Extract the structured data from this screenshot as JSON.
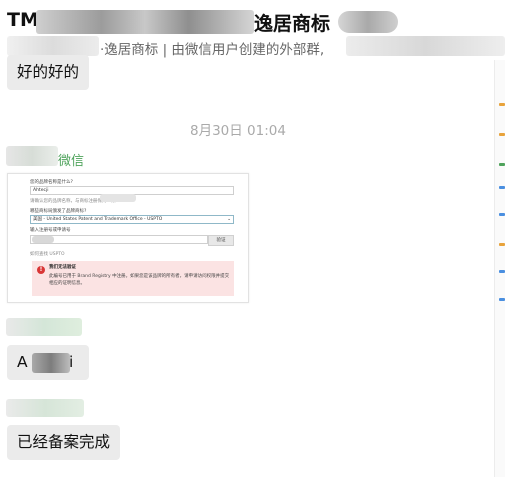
{
  "header": {
    "title_prefix": "TM",
    "title_suffix": "逸居商标",
    "subtitle": "·逸居商标 | 由微信用户创建的外部群,"
  },
  "messages": {
    "m1": "好的好的",
    "timestamp": "8月30日 01:04",
    "sender_suffix": "微信",
    "m3_prefix": "A",
    "m3_suffix": "i",
    "m4": "已经备案完成"
  },
  "shared_screenshot": {
    "q1_label": "您的品牌名称是什么?",
    "q1_value": "Ahtecji",
    "q1_hint": "请确认您的品牌名称，与商标注册保持一致",
    "q2_label": "哪些商标局颁发了品牌商标?",
    "q2_value": "美国 - United States Patent and Trademark Office - USPTO",
    "q3_label": "输入注册号或申请号",
    "verify_button": "验证",
    "q3_hint": "如何查找 USPTO",
    "error_title": "我们无法验证",
    "error_body_1": "此编号已用于 Brand Registry 中注册。如果您是该品牌的所有者，请申请访问权限并提交",
    "error_body_2": "相应的证明信息。"
  },
  "colors": {
    "bubble": "#ebebeb",
    "sender_green": "#4fa35c",
    "error_bg": "#fbe3e3",
    "error_red": "#d93636",
    "arrow_orange": "#e8a33c",
    "arrow_blue": "#4a8fe0"
  }
}
